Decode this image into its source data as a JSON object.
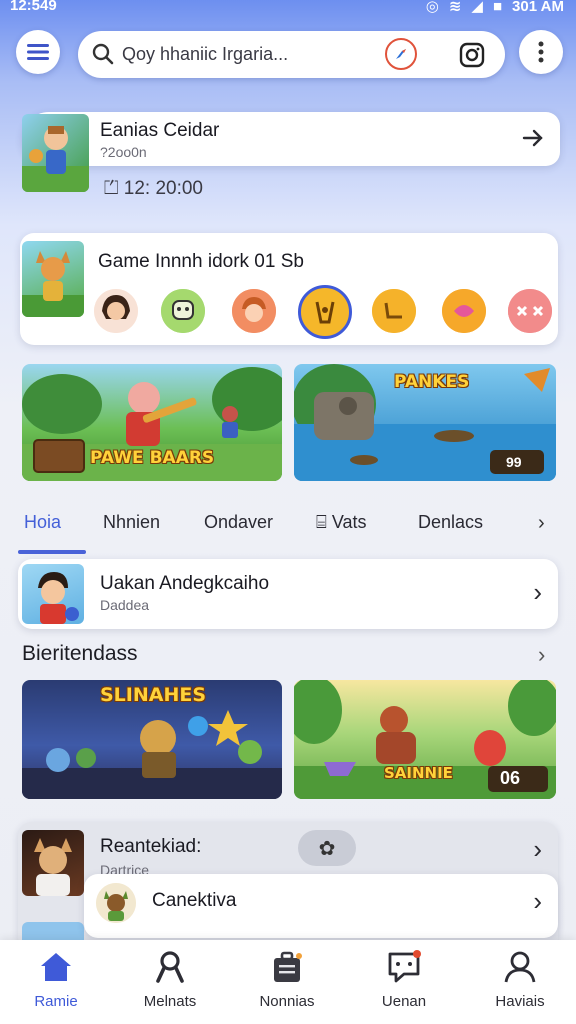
{
  "status_bar": {
    "time": "12:549",
    "right_text": "301 AM"
  },
  "header": {
    "search_text": "Qoy hhaniic Irgaria..."
  },
  "event_card": {
    "title": "Eanias Ceidar",
    "subtitle": "?2oo0n",
    "time_label": "12: 20:00"
  },
  "friends_card": {
    "title": "Game Innnh idork 01 Sb"
  },
  "banners": [
    {
      "label": "PAWE BAARS",
      "badge": ""
    },
    {
      "label": "PANKES",
      "badge": "99"
    }
  ],
  "tabs": [
    {
      "label": "Hoia"
    },
    {
      "label": "Nhnien"
    },
    {
      "label": "Ondaver"
    },
    {
      "label": "Vats"
    },
    {
      "label": "Denlacs"
    }
  ],
  "feature_row": {
    "title": "Uakan Andegkcaiho",
    "subtitle": "Daddea"
  },
  "section": {
    "title": "Bieritendass"
  },
  "games": [
    {
      "label": "SLINAHES",
      "badge": ""
    },
    {
      "label": "SAINNIE",
      "badge": "06"
    }
  ],
  "recent_card": {
    "title": "Reantekiad:",
    "subtitle": "Dartrice"
  },
  "popup_card": {
    "title": "Canektiva"
  },
  "bottom_nav": [
    {
      "label": "Ramie"
    },
    {
      "label": "Melnats"
    },
    {
      "label": "Nonnias"
    },
    {
      "label": "Uenan"
    },
    {
      "label": "Haviais"
    }
  ],
  "colors": {
    "accent": "#4460d8",
    "header_gradient_top": "#6d8ff0",
    "background": "#eceef4"
  }
}
